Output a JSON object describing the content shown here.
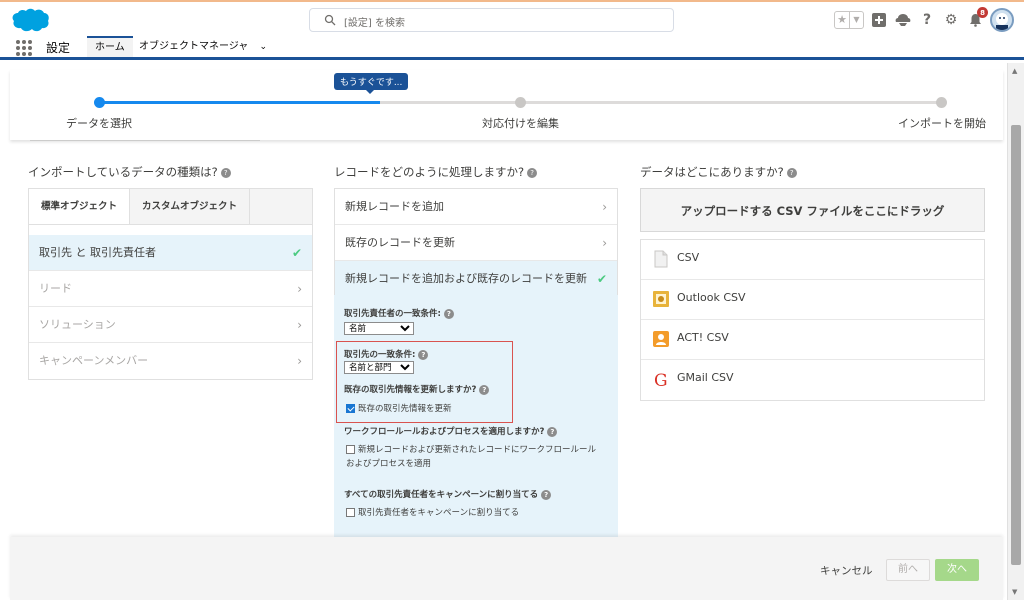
{
  "header": {
    "search_placeholder": "[設定] を検索",
    "notification_count": "8",
    "star_icon": "star-icon",
    "icons": [
      "add-icon",
      "trailhead-icon",
      "help-icon",
      "gear-icon",
      "bell-icon"
    ]
  },
  "nav": {
    "app_name": "設定",
    "tabs": [
      {
        "label": "ホーム",
        "active": true
      },
      {
        "label": "オブジェクトマネージャ",
        "active": false
      }
    ]
  },
  "progress": {
    "tooltip": "もうすぐです...",
    "steps": [
      "データを選択",
      "対応付けを編集",
      "インポートを開始"
    ],
    "completed_fraction": 0.333
  },
  "left_column": {
    "title": "インポートしているデータの種類は?",
    "tabs": [
      "標準オブジェクト",
      "カスタムオブジェクト"
    ],
    "items": [
      {
        "label": "取引先 と 取引先責任者",
        "selected": true
      },
      {
        "label": "リード",
        "selected": false
      },
      {
        "label": "ソリューション",
        "selected": false
      },
      {
        "label": "キャンペーンメンバー",
        "selected": false
      }
    ]
  },
  "middle_column": {
    "title": "レコードをどのように処理しますか?",
    "options": [
      {
        "label": "新規レコードを追加",
        "selected": false
      },
      {
        "label": "既存のレコードを更新",
        "selected": false
      },
      {
        "label": "新規レコードを追加および既存のレコードを更新",
        "selected": true
      }
    ],
    "contact_match_label": "取引先責任者の一致条件:",
    "contact_match_value": "名前",
    "account_match_label": "取引先の一致条件:",
    "account_match_value": "名前と部門",
    "update_account_label": "既存の取引先情報を更新しますか?",
    "update_account_checkbox": "既存の取引先情報を更新",
    "workflow_label": "ワークフロールールおよびプロセスを適用しますか?",
    "workflow_checkbox_line1": "新規レコードおよび更新されたレコードにワークフロールール",
    "workflow_checkbox_line2": "およびプロセスを適用",
    "campaign_label": "すべての取引先責任者をキャンペーンに割り当てる",
    "campaign_checkbox": "取引先責任者をキャンペーンに割り当てる"
  },
  "right_column": {
    "title": "データはどこにありますか?",
    "drop_zone": "アップロードする CSV ファイルをここにドラッグ",
    "sources": [
      {
        "label": "CSV",
        "icon": "csv-file-icon"
      },
      {
        "label": "Outlook CSV",
        "icon": "outlook-icon"
      },
      {
        "label": "ACT! CSV",
        "icon": "act-contact-icon"
      },
      {
        "label": "GMail CSV",
        "icon": "gmail-icon"
      }
    ]
  },
  "footer": {
    "cancel": "キャンセル",
    "prev": "前へ",
    "next": "次へ"
  },
  "colors": {
    "accent": "#1589ee",
    "selected_bg": "#e6f3fa",
    "check": "#4bca81",
    "next_button": "#a5d88a"
  }
}
